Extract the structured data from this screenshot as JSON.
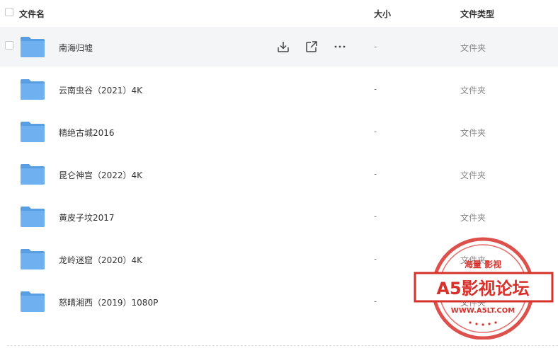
{
  "header": {
    "name_label": "文件名",
    "size_label": "大小",
    "type_label": "文件类型"
  },
  "files": [
    {
      "name": "南海归墟",
      "size": "-",
      "type": "文件夹"
    },
    {
      "name": "云南虫谷（2021）4K",
      "size": "-",
      "type": "文件夹"
    },
    {
      "name": "精绝古城2016",
      "size": "-",
      "type": "文件夹"
    },
    {
      "name": "昆仑神宫（2022）4K",
      "size": "-",
      "type": "文件夹"
    },
    {
      "name": "黄皮子坟2017",
      "size": "-",
      "type": "文件夹"
    },
    {
      "name": "龙岭迷窟（2020）4K",
      "size": "-",
      "type": "文件夹"
    },
    {
      "name": "怒晴湘西（2019）1080P",
      "size": "-",
      "type": "文件夹"
    }
  ],
  "hover_actions": [
    "download-icon",
    "share-icon",
    "more-icon"
  ],
  "watermark": {
    "top_text": "海量 影视",
    "main_text": "A5影视论坛",
    "url": "WWW.A5LT.COM"
  },
  "colors": {
    "folder": "#6fb1f0",
    "folder_dark": "#5a9ee2",
    "hover_row": "#f4f5f7",
    "stamp_red": "#d6322c"
  }
}
